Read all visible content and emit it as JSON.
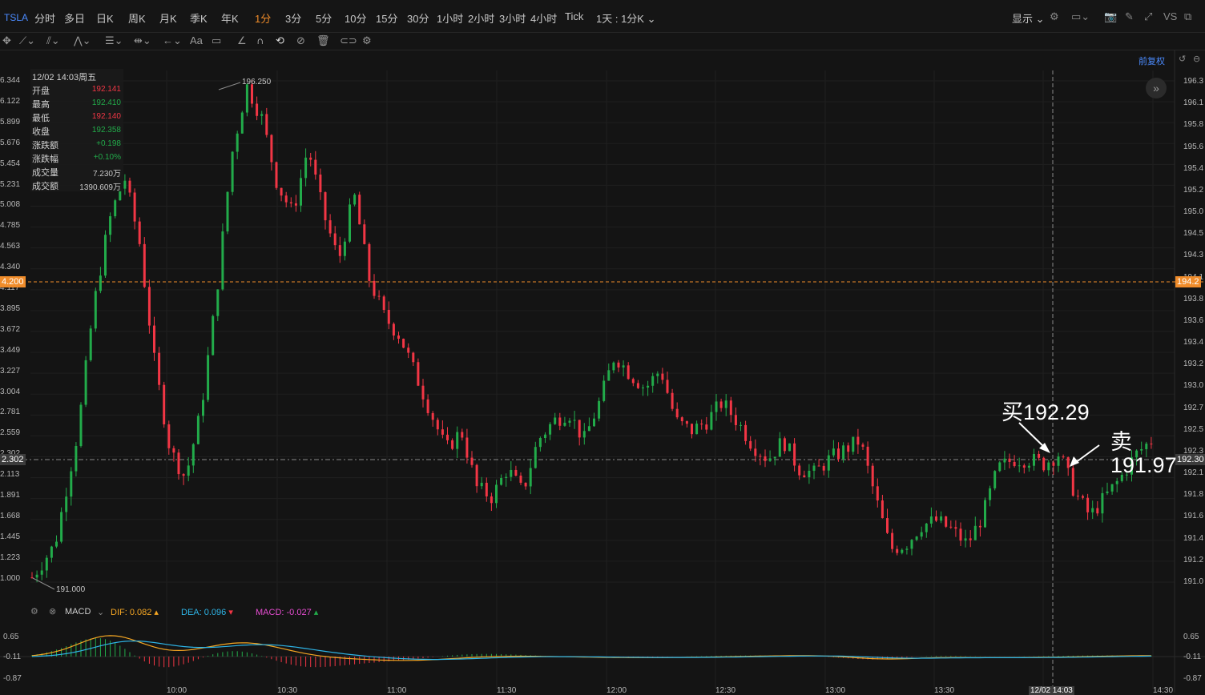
{
  "top_bar": {
    "symbol": "TSLA",
    "timeframes": [
      "分时",
      "多日",
      "日K",
      "周K",
      "月K",
      "季K",
      "年K",
      "1分",
      "3分",
      "5分",
      "10分",
      "15分",
      "30分",
      "1小时",
      "2小时",
      "3小时",
      "4小时",
      "Tick"
    ],
    "active_timeframe": "1分",
    "range_selector": "1天 : 1分K",
    "display_label": "显示",
    "vs_label": "VS"
  },
  "toolbar": {
    "text_tool": "Aa"
  },
  "main_chart": {
    "adjust_label": "前复权",
    "info_box": {
      "datetime": "12/02 14:03周五",
      "rows": [
        {
          "k": "开盘",
          "v": "192.141",
          "color": "#f23645"
        },
        {
          "k": "最高",
          "v": "192.410",
          "color": "#22ab4a"
        },
        {
          "k": "最低",
          "v": "192.140",
          "color": "#f23645"
        },
        {
          "k": "收盘",
          "v": "192.358",
          "color": "#22ab4a"
        },
        {
          "k": "涨跌额",
          "v": "+0.198",
          "color": "#22ab4a"
        },
        {
          "k": "涨跌幅",
          "v": "+0.10%",
          "color": "#22ab4a"
        },
        {
          "k": "成交量",
          "v": "7.230万",
          "color": "#c8c8c8"
        },
        {
          "k": "成交额",
          "v": "1390.609万",
          "color": "#c8c8c8"
        }
      ]
    },
    "left_axis_labels": [
      "6.344",
      "6.122",
      "5.899",
      "5.676",
      "5.454",
      "5.231",
      "5.008",
      "4.785",
      "4.563",
      "4.340",
      "4.117",
      "3.895",
      "3.672",
      "3.449",
      "3.227",
      "3.004",
      "2.781",
      "2.559",
      "2.302",
      "2.113",
      "1.891",
      "1.668",
      "1.445",
      "1.223",
      "1.000"
    ],
    "right_axis_labels": [
      "196.3",
      "196.1",
      "195.8",
      "195.6",
      "195.4",
      "195.2",
      "195.0",
      "194.5",
      "194.3",
      "194.1",
      "193.8",
      "193.6",
      "193.4",
      "193.2",
      "193.0",
      "192.7",
      "192.5",
      "192.3",
      "192.1",
      "191.8",
      "191.6",
      "191.4",
      "191.2",
      "191.0"
    ],
    "ref_line_label_left": "4.200",
    "ref_line_label_right": "194.2",
    "crosshair_label_left": "2.302",
    "crosshair_label_right": "192.30",
    "high_marker": "196.250",
    "low_marker": "191.000",
    "annotations": {
      "buy": "买192.29",
      "sell_1": "卖",
      "sell_2": "191.97"
    },
    "time_labels": [
      "10:00",
      "10:30",
      "11:00",
      "11:30",
      "12:00",
      "12:30",
      "13:00",
      "13:30",
      "12/02 14:03",
      "14:30"
    ]
  },
  "macd": {
    "name": "MACD",
    "dif_label": "DIF:",
    "dif_value": "0.082",
    "dea_label": "DEA:",
    "dea_value": "0.096",
    "macd_label": "MACD:",
    "macd_value": "-0.027",
    "axis_labels": [
      "0.65",
      "-0.11",
      "-0.87"
    ]
  },
  "colors": {
    "up": "#22ab4a",
    "down": "#f23645",
    "ref": "#f08c2a",
    "dif": "#f5a623",
    "dea": "#2eb4e6",
    "macd": "#e64cd1"
  },
  "chart_data": {
    "type": "candlestick",
    "title": "TSLA 1分",
    "ylim": [
      191.0,
      196.3
    ],
    "close_path": [
      [
        0,
        191.05
      ],
      [
        3,
        191.4
      ],
      [
        6,
        192.6
      ],
      [
        8,
        193.9
      ],
      [
        10,
        194.8
      ],
      [
        12,
        195.3
      ],
      [
        14,
        194.6
      ],
      [
        16,
        193.3
      ],
      [
        18,
        192.4
      ],
      [
        20,
        192.1
      ],
      [
        22,
        192.8
      ],
      [
        24,
        194.0
      ],
      [
        26,
        195.5
      ],
      [
        28,
        196.25
      ],
      [
        30,
        195.9
      ],
      [
        32,
        195.2
      ],
      [
        34,
        194.9
      ],
      [
        36,
        195.6
      ],
      [
        38,
        194.9
      ],
      [
        40,
        194.4
      ],
      [
        42,
        195.1
      ],
      [
        44,
        194.2
      ],
      [
        46,
        193.8
      ],
      [
        48,
        193.6
      ],
      [
        50,
        193.2
      ],
      [
        52,
        192.8
      ],
      [
        54,
        192.4
      ],
      [
        56,
        192.6
      ],
      [
        58,
        192.0
      ],
      [
        60,
        191.9
      ],
      [
        62,
        192.2
      ],
      [
        64,
        191.95
      ],
      [
        66,
        192.5
      ],
      [
        68,
        192.7
      ],
      [
        70,
        192.8
      ],
      [
        72,
        192.5
      ],
      [
        74,
        192.9
      ],
      [
        76,
        193.4
      ],
      [
        78,
        193.2
      ],
      [
        80,
        193.05
      ],
      [
        82,
        193.25
      ],
      [
        84,
        192.7
      ],
      [
        86,
        192.6
      ],
      [
        88,
        192.7
      ],
      [
        90,
        192.9
      ],
      [
        92,
        192.7
      ],
      [
        94,
        192.45
      ],
      [
        96,
        192.3
      ],
      [
        98,
        192.5
      ],
      [
        100,
        192.2
      ],
      [
        102,
        192.15
      ],
      [
        104,
        192.3
      ],
      [
        106,
        192.4
      ],
      [
        108,
        192.5
      ],
      [
        110,
        191.9
      ],
      [
        112,
        191.35
      ],
      [
        114,
        191.4
      ],
      [
        116,
        191.6
      ],
      [
        118,
        191.65
      ],
      [
        120,
        191.55
      ],
      [
        122,
        191.4
      ],
      [
        124,
        191.7
      ],
      [
        126,
        192.2
      ],
      [
        128,
        192.3
      ],
      [
        130,
        192.3
      ],
      [
        132,
        192.25
      ],
      [
        134,
        192.36
      ],
      [
        136,
        191.95
      ],
      [
        138,
        191.7
      ],
      [
        140,
        191.9
      ],
      [
        142,
        192.1
      ],
      [
        144,
        192.35
      ],
      [
        146,
        192.5
      ]
    ]
  }
}
